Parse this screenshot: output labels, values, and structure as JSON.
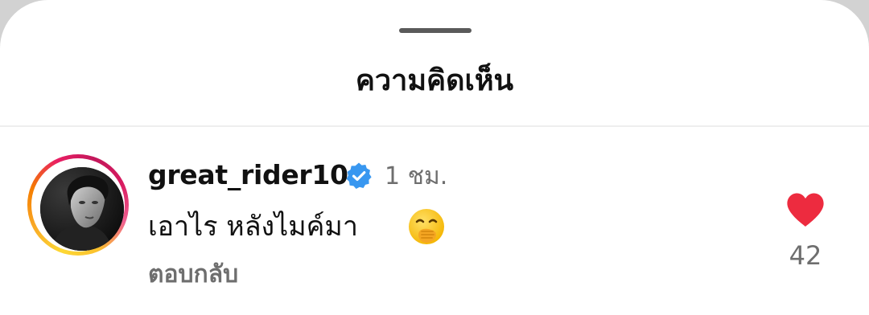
{
  "sheet": {
    "title": "ความคิดเห็น"
  },
  "comment": {
    "username": "great_rider10",
    "verified": true,
    "timestamp": "1 ชม.",
    "text": "เอาไร หลังไมค์มา",
    "emoji": "face-with-hand-over-mouth",
    "reply_label": "ตอบกลับ",
    "like_count": "42",
    "liked": true,
    "avatar": "black-and-white-portrait"
  },
  "colors": {
    "like_red": "#ed2b3f",
    "verified_blue": "#3897f0",
    "secondary_text": "#6e6e6e",
    "primary_text": "#111111",
    "story_ring": [
      "#fdd835",
      "#f57c00",
      "#e91e63"
    ]
  }
}
